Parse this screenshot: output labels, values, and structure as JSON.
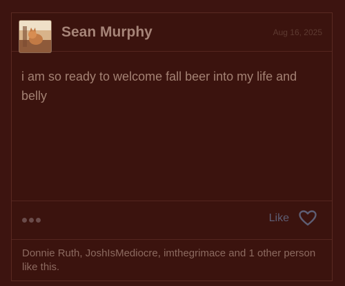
{
  "post": {
    "author": "Sean Murphy",
    "timestamp": "Aug 16, 2025",
    "body": "i am so ready to welcome fall beer into my life and belly",
    "like_label": "Like",
    "likers_text": "Donnie Ruth, JoshIsMediocre, imthegrimace and 1 other person like this."
  },
  "icons": {
    "more": "more-dots-icon",
    "like": "heart-outline-icon"
  },
  "colors": {
    "background": "#3d1410",
    "author": "#a68478",
    "body_text": "#a38173",
    "like_accent": "#5e5e74",
    "meta_text": "#8c6a60"
  }
}
